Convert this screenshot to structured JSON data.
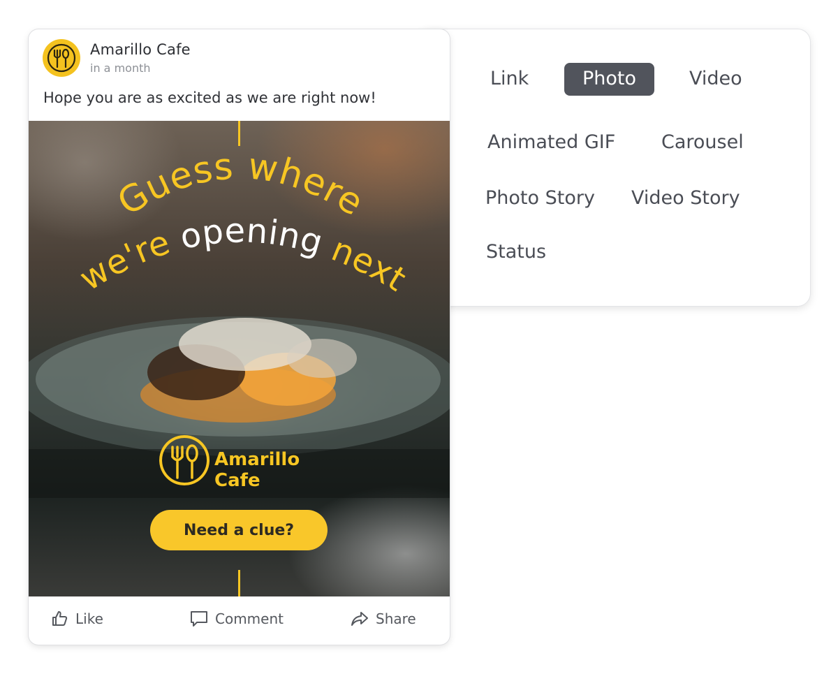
{
  "post": {
    "page_name": "Amarillo Cafe",
    "time": "in a month",
    "caption": "Hope you are as excited as we are right now!",
    "image": {
      "headline_line1": "Guess where",
      "headline_line2_a": "we're",
      "headline_line2_b": "opening",
      "headline_line2_c": "next",
      "logo_line1": "Amarillo",
      "logo_line2": "Cafe",
      "cta": "Need a clue?"
    },
    "actions": {
      "like": "Like",
      "comment": "Comment",
      "share": "Share"
    }
  },
  "post_types": {
    "selected": "Photo",
    "options": [
      "Link",
      "Photo",
      "Video",
      "Animated GIF",
      "Carousel",
      "Photo Story",
      "Video Story",
      "Status"
    ]
  },
  "colors": {
    "brand_yellow": "#f7c623",
    "active_option_bg": "#51545c",
    "text_gray": "#4a4d55"
  },
  "icons": {
    "avatar": "fork-spoon-logo-icon",
    "like": "thumbs-up-icon",
    "comment": "comment-icon",
    "share": "share-arrow-icon"
  }
}
